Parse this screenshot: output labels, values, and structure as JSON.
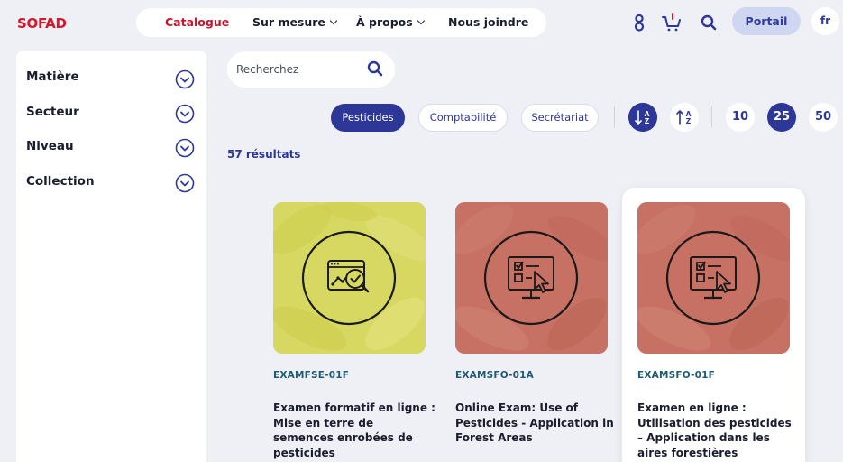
{
  "header": {
    "logo": "SOFAD",
    "nav": [
      {
        "label": "Catalogue",
        "active": true,
        "dropdown": false
      },
      {
        "label": "Sur mesure",
        "active": false,
        "dropdown": true
      },
      {
        "label": "À propos",
        "active": false,
        "dropdown": true
      },
      {
        "label": "Nous joindre",
        "active": false,
        "dropdown": false
      }
    ],
    "icons": [
      "user-icon",
      "cart-icon",
      "search-icon"
    ],
    "portal_label": "Portail",
    "language": "fr"
  },
  "sidebar": {
    "facets": [
      {
        "label": "Matière"
      },
      {
        "label": "Secteur"
      },
      {
        "label": "Niveau"
      },
      {
        "label": "Collection"
      }
    ]
  },
  "search": {
    "placeholder": "Recherchez",
    "value": ""
  },
  "filters": {
    "chips": [
      {
        "label": "Pesticides",
        "selected": true
      },
      {
        "label": "Comptabilité",
        "selected": false
      },
      {
        "label": "Secrétariat",
        "selected": false
      }
    ],
    "sort": [
      {
        "icon": "sort-az-icon",
        "selected": true
      },
      {
        "icon": "sort-za-icon",
        "selected": false
      }
    ],
    "page_sizes": [
      {
        "label": "10",
        "selected": false
      },
      {
        "label": "25",
        "selected": true
      },
      {
        "label": "50",
        "selected": false
      }
    ]
  },
  "results_count": "57 résultats",
  "products": [
    {
      "code": "EXAMFSE-01F",
      "title": "Examen formatif en ligne : Mise en terre de semences enrobées de pesticides",
      "theme": "yellow-green",
      "icon": "browser-analytics-check-icon"
    },
    {
      "code": "EXAMSFO-01A",
      "title": "Online Exam: Use of Pesticides - Application in Forest Areas",
      "theme": "rose",
      "icon": "monitor-checklist-cursor-icon"
    },
    {
      "code": "EXAMSFO-01F",
      "title": "Examen en ligne : Utilisation des pesticides – Application dans les aires forestières",
      "theme": "rose",
      "icon": "monitor-checklist-cursor-icon",
      "highlighted": true
    }
  ],
  "colors": {
    "brand_red": "#d3182b",
    "primary_blue": "#2c3797",
    "portal_bg": "#cfd6f2",
    "code_teal": "#1f5a75",
    "thumb_yellow": "#d7d862",
    "thumb_rose": "#c67163"
  }
}
